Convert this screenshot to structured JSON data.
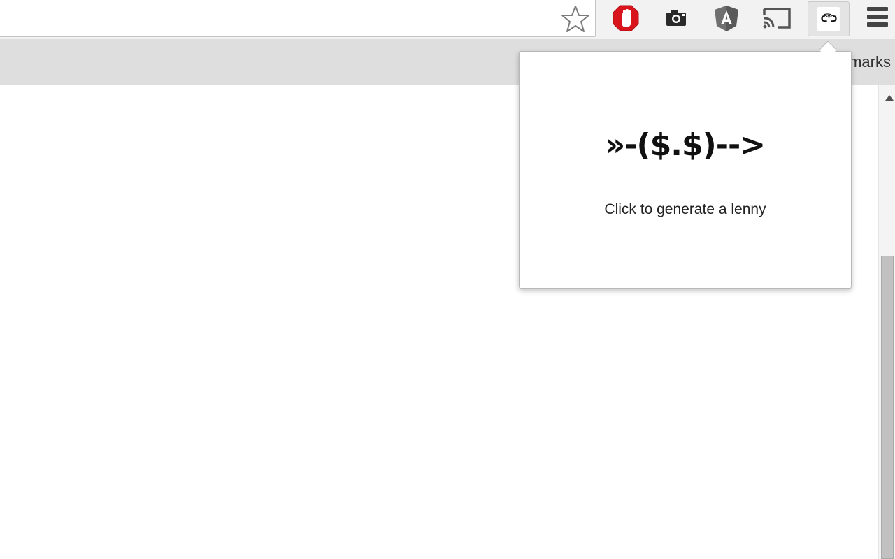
{
  "browser": {
    "bookmarks_bar": {
      "label": "marks"
    },
    "extensions": [
      {
        "name": "star-icon"
      },
      {
        "name": "adblock-icon"
      },
      {
        "name": "camera-icon"
      },
      {
        "name": "angular-icon"
      },
      {
        "name": "cast-icon"
      },
      {
        "name": "lenny-extension-icon",
        "badge": "ᕦ͡°ᕤ",
        "active": true
      },
      {
        "name": "menu-icon"
      }
    ],
    "colors": {
      "adblock_red": "#d8141c",
      "angular_gray": "#707070",
      "toolbar_bg": "#f2f2f2",
      "bookmarks_bg": "#dedede"
    }
  },
  "popup": {
    "lenny": "»-($.$)-->",
    "caption": "Click to generate a lenny"
  }
}
